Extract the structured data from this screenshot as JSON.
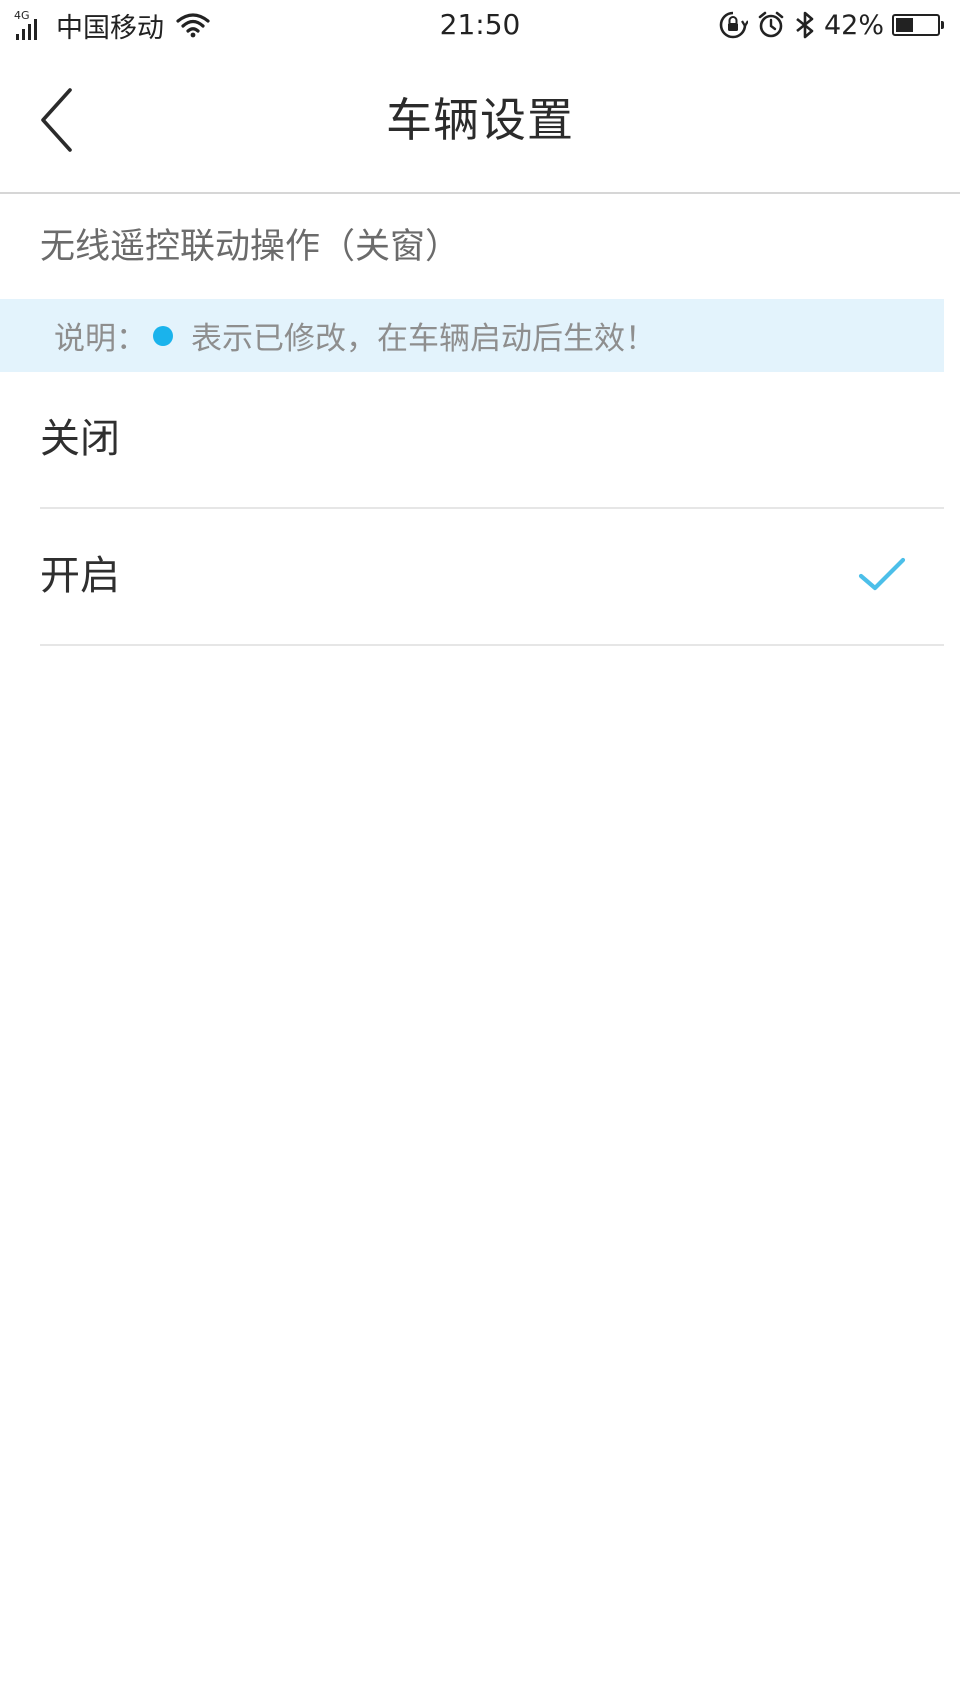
{
  "status_bar": {
    "network_tag": "4G",
    "carrier": "中国移动",
    "time": "21:50",
    "battery_percent_text": "42%",
    "battery_level": 0.42,
    "icons": [
      "signal-icon",
      "wifi-icon",
      "rotation-lock-icon",
      "alarm-icon",
      "bluetooth-icon",
      "battery-icon"
    ]
  },
  "header": {
    "title": "车辆设置",
    "back_icon": "chevron-left-icon"
  },
  "section": {
    "title": "无线遥控联动操作（关窗）"
  },
  "notice": {
    "label": "说明：",
    "text": "表示已修改，在车辆启动后生效！",
    "dot_color": "#1ab3ec"
  },
  "options": [
    {
      "label": "关闭",
      "selected": false
    },
    {
      "label": "开启",
      "selected": true
    }
  ],
  "colors": {
    "accent": "#4cbfe9",
    "banner_bg": "#e3f3fc",
    "divider": "#e6e6e6"
  }
}
